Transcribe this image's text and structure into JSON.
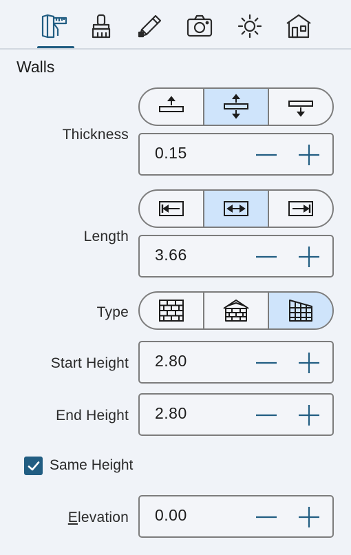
{
  "toolbar": {
    "tabs": [
      {
        "icon": "wall-measure-icon",
        "active": true
      },
      {
        "icon": "paint-brush-icon",
        "active": false
      },
      {
        "icon": "pencil-icon",
        "active": false
      },
      {
        "icon": "camera-icon",
        "active": false
      },
      {
        "icon": "sun-icon",
        "active": false
      },
      {
        "icon": "house-icon",
        "active": false
      }
    ]
  },
  "section": {
    "title": "Walls"
  },
  "thickness": {
    "label": "Thickness",
    "value": "0.15",
    "options": [
      "align-top-icon",
      "align-center-icon",
      "align-bottom-icon"
    ],
    "selected": 1
  },
  "length": {
    "label": "Length",
    "value": "3.66",
    "options": [
      "arrow-left-icon",
      "arrow-both-icon",
      "arrow-right-icon"
    ],
    "selected": 1
  },
  "type": {
    "label": "Type",
    "options": [
      "brick-wall-icon",
      "roof-wall-icon",
      "grid-wall-icon"
    ],
    "selected": 2
  },
  "start_height": {
    "label": "Start Height",
    "value": "2.80"
  },
  "end_height": {
    "label": "End Height",
    "value": "2.80"
  },
  "same_height": {
    "label": "Same Height",
    "checked": true
  },
  "elevation": {
    "label_underlined": "E",
    "label_rest": "levation",
    "value": "0.00"
  },
  "colors": {
    "accent": "#215d82",
    "active_segment": "#cfe4fb",
    "border": "#7c7c7c",
    "background": "#f0f3f8"
  }
}
